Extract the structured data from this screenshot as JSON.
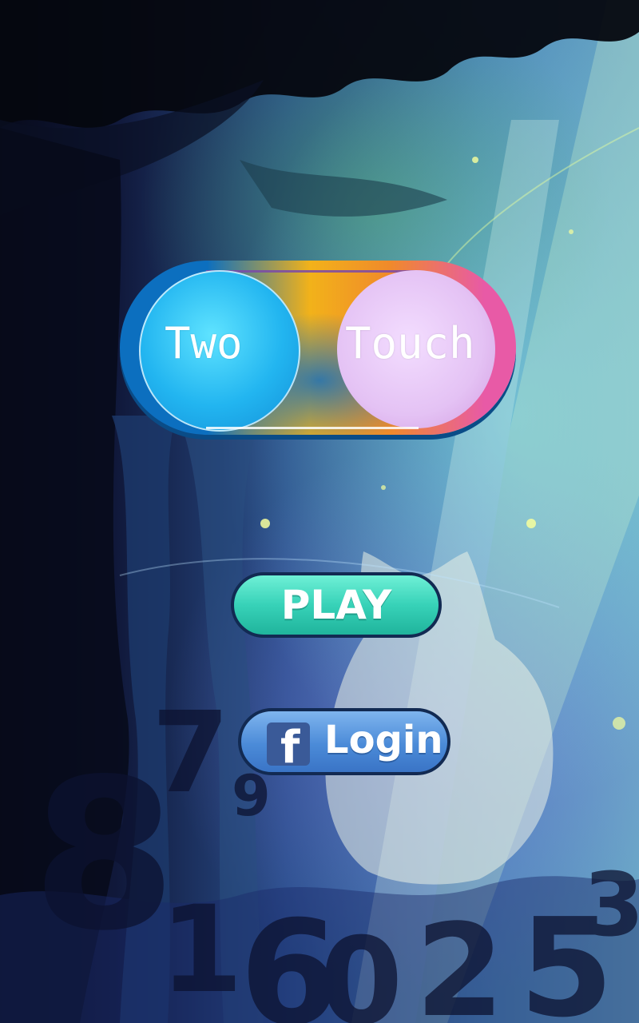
{
  "logo": {
    "word_left": "Two",
    "word_right": "Touch"
  },
  "buttons": {
    "play_label": "PLAY",
    "login_label": "Login",
    "facebook_glyph": "f"
  },
  "background": {
    "numbers": [
      "7",
      "9",
      "8",
      "1",
      "6",
      "0",
      "2",
      "5",
      "3"
    ]
  },
  "colors": {
    "play_button": "#37d2b8",
    "login_button": "#4b8bd8",
    "facebook_blue": "#3a5a98",
    "logo_blue": "#22b5f0",
    "logo_pink": "#e4c2f4",
    "logo_orange": "#f2b21a"
  },
  "icons": {
    "login_icon": "facebook-icon"
  }
}
